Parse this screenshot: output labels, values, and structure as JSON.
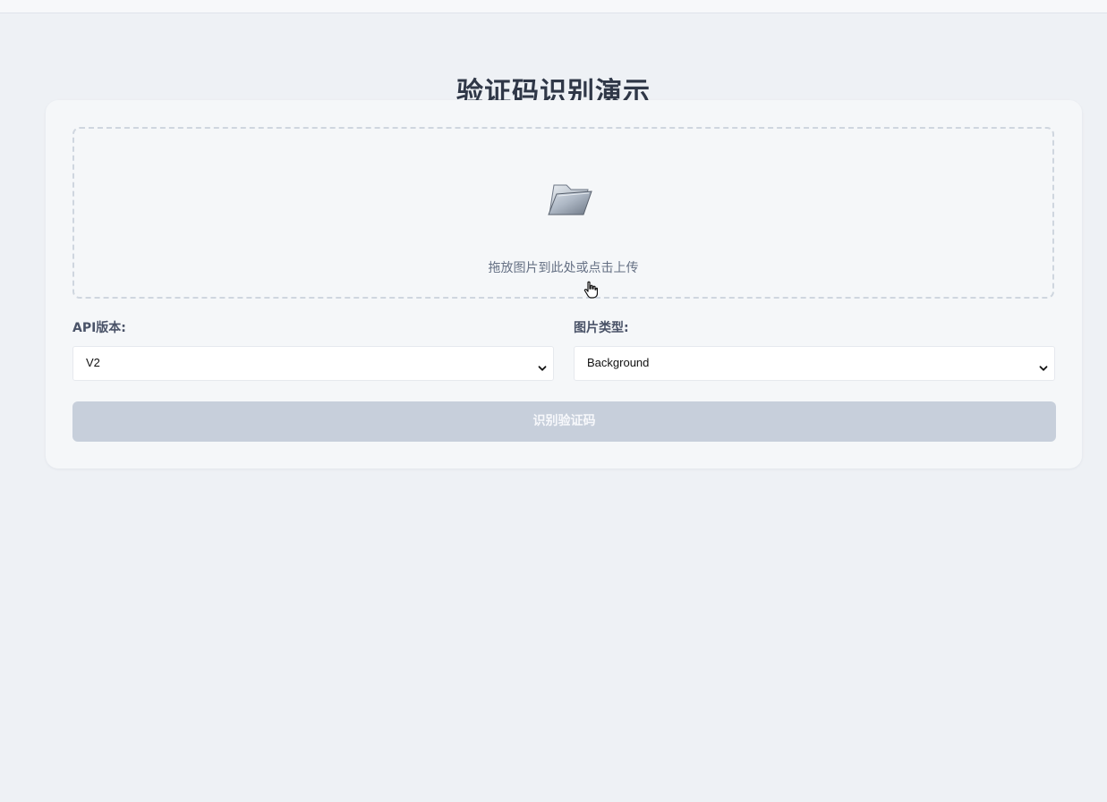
{
  "page": {
    "title": "验证码识别演示"
  },
  "upload": {
    "icon": "folder-icon",
    "hint": "拖放图片到此处或点击上传"
  },
  "api_version": {
    "label": "API版本:",
    "selected": "V2"
  },
  "image_type": {
    "label": "图片类型:",
    "selected": "Background"
  },
  "actions": {
    "recognize_label": "识别验证码"
  },
  "colors": {
    "background": "#eef1f5",
    "card": "#f5f7f9",
    "title": "#2f3747",
    "disabled_button": "#c7cfdb"
  }
}
